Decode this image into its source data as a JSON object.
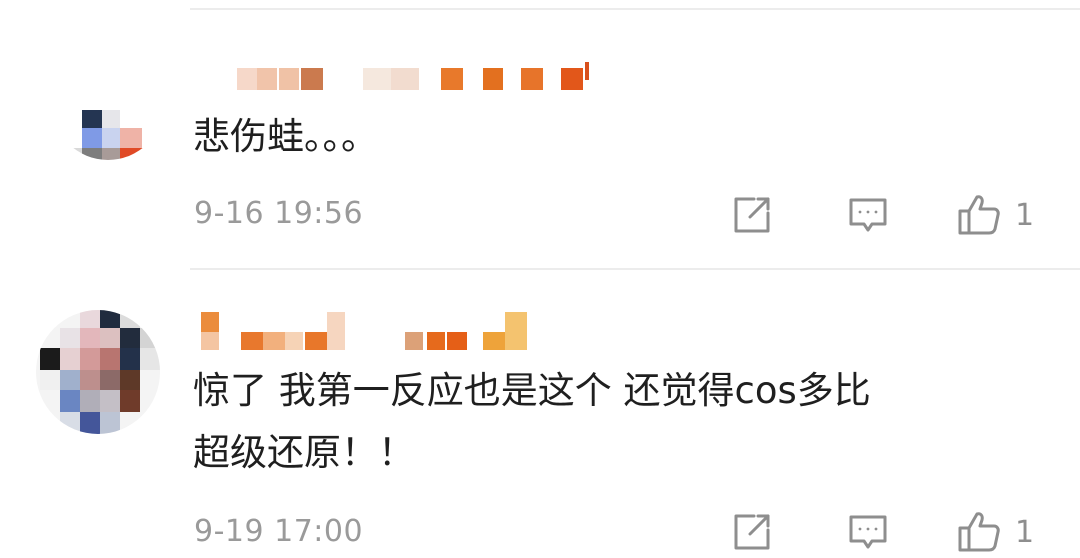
{
  "comments": [
    {
      "text": "悲伤蛙。。。",
      "time": "9-16 19:56",
      "likes": "1",
      "actions": {
        "share_icon": "share-icon",
        "reply_icon": "comment-icon",
        "like_icon": "thumbs-up-icon"
      }
    },
    {
      "text": "惊了 我第一反应也是这个 还觉得cos多比\n超级还原！！",
      "time": "9-19 17:00",
      "likes": "1",
      "actions": {
        "share_icon": "share-icon",
        "reply_icon": "comment-icon",
        "like_icon": "thumbs-up-icon"
      }
    }
  ],
  "colors": {
    "text": "#1f1f1f",
    "meta": "#9a9a9a",
    "divider": "#ececec",
    "icon": "#8e8e8e"
  }
}
